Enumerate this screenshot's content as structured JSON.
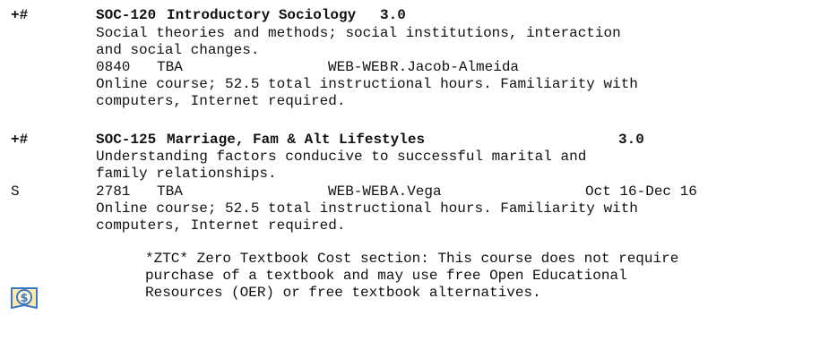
{
  "courses": [
    {
      "flags": "+#",
      "code": "SOC-120",
      "title": "Introductory Sociology",
      "units": "3.0",
      "description": [
        "Social theories and methods; social institutions, interaction",
        "and social changes."
      ],
      "section": {
        "prefix": "",
        "number": "0840",
        "time": "TBA",
        "location": "WEB-WEB",
        "instructor": "R.Jacob-Almeida",
        "dates": ""
      },
      "notes": [
        "Online course; 52.5 total instructional hours. Familiarity with",
        "computers, Internet required."
      ]
    },
    {
      "flags": "+#",
      "code": "SOC-125",
      "title": "Marriage, Fam & Alt Lifestyles",
      "units": "3.0",
      "description": [
        "Understanding factors conducive to successful marital and",
        "family relationships."
      ],
      "section": {
        "prefix": "S",
        "number": "2781",
        "time": "TBA",
        "location": "WEB-WEB",
        "instructor": "A.Vega",
        "dates": "Oct 16-Dec 16"
      },
      "notes": [
        "Online course; 52.5 total instructional hours. Familiarity with",
        "computers, Internet required."
      ],
      "ztc": {
        "icon": "zero-textbook-cost-icon",
        "text": [
          "*ZTC* Zero Textbook Cost section: This course does not require",
          "purchase of a textbook and may use free Open Educational",
          "Resources (OER) or free textbook alternatives."
        ]
      }
    }
  ],
  "colors": {
    "text": "#111111",
    "icon_fill": "#ffe9a8",
    "icon_stroke": "#3d78c4"
  }
}
